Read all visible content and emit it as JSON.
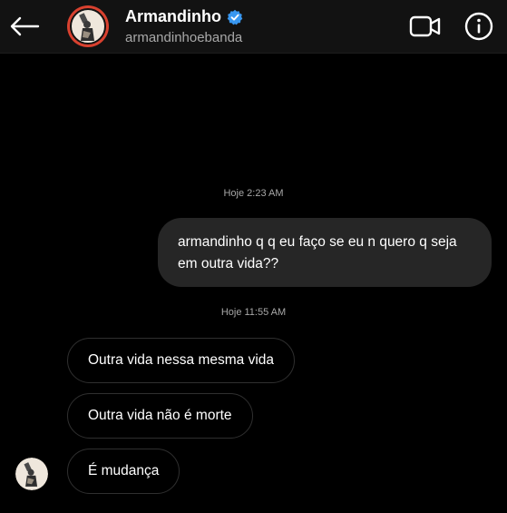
{
  "header": {
    "contact_name": "Armandinho",
    "username": "armandinhoebanda",
    "verified_badge_color": "#3897f0",
    "back_icon": "arrow-left-icon",
    "video_icon": "video-camera-icon",
    "info_icon": "info-icon"
  },
  "messages": {
    "timestamp_1": "Hoje 2:23 AM",
    "sent_1": "armandinho q q eu faço se eu n quero q seja em outra vida??",
    "timestamp_2": "Hoje 11:55 AM",
    "received_1": "Outra vida nessa mesma vida",
    "received_2": "Outra vida não é morte",
    "received_3": "É mudança"
  },
  "colors": {
    "background": "#000000",
    "header_bg": "#121212",
    "sent_bubble": "#262626",
    "received_border": "#2f2f2f",
    "muted_text": "#a8a8a8",
    "story_ring": "#d9412f"
  }
}
